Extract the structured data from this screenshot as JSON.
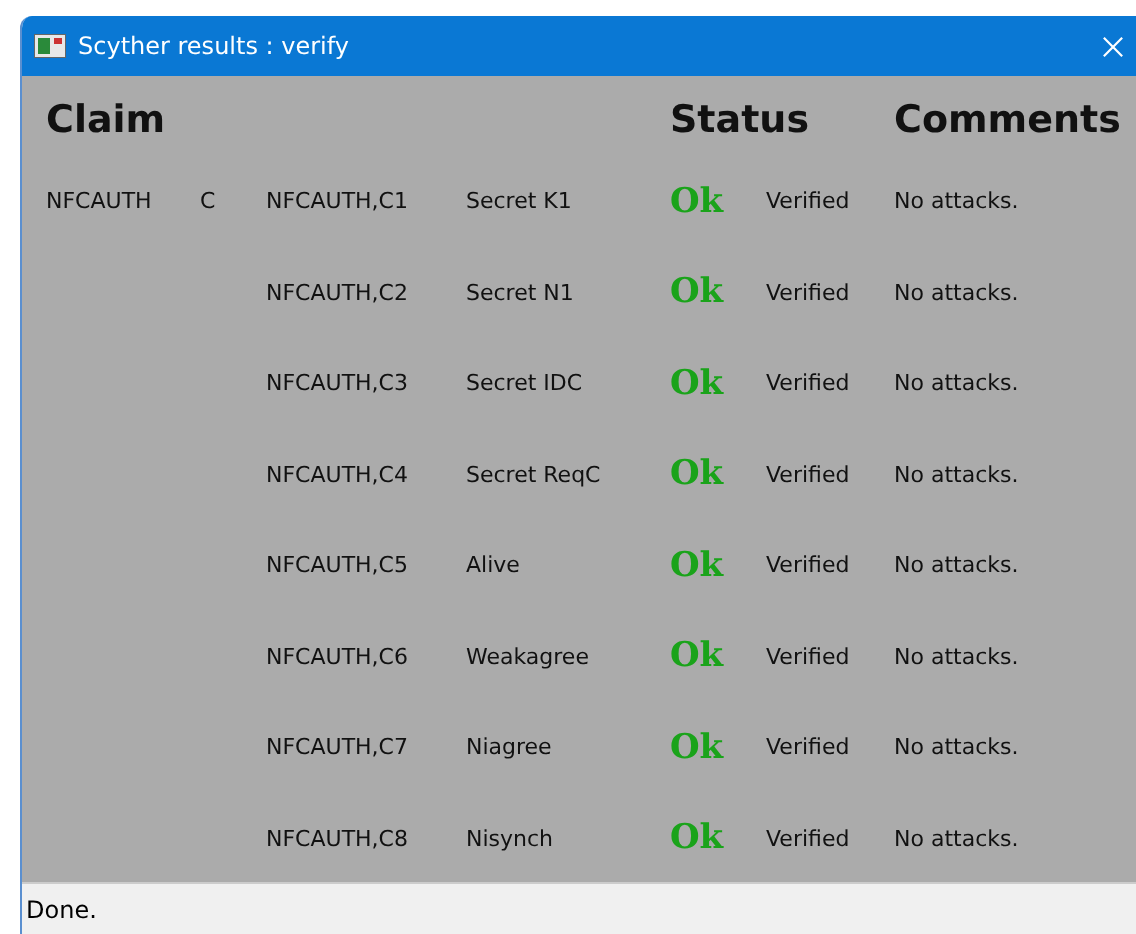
{
  "window": {
    "title": "Scyther results : verify"
  },
  "headers": {
    "claim": "Claim",
    "status": "Status",
    "comments": "Comments"
  },
  "rows": [
    {
      "protocol": "NFCAUTH",
      "role": "C",
      "claim_id": "NFCAUTH,C1",
      "claim": "Secret K1",
      "result": "Ok",
      "status": "Verified",
      "comment": "No attacks."
    },
    {
      "claim_id": "NFCAUTH,C2",
      "claim": "Secret N1",
      "result": "Ok",
      "status": "Verified",
      "comment": "No attacks."
    },
    {
      "claim_id": "NFCAUTH,C3",
      "claim": "Secret IDC",
      "result": "Ok",
      "status": "Verified",
      "comment": "No attacks."
    },
    {
      "claim_id": "NFCAUTH,C4",
      "claim": "Secret ReqC",
      "result": "Ok",
      "status": "Verified",
      "comment": "No attacks."
    },
    {
      "claim_id": "NFCAUTH,C5",
      "claim": "Alive",
      "result": "Ok",
      "status": "Verified",
      "comment": "No attacks."
    },
    {
      "claim_id": "NFCAUTH,C6",
      "claim": "Weakagree",
      "result": "Ok",
      "status": "Verified",
      "comment": "No attacks."
    },
    {
      "claim_id": "NFCAUTH,C7",
      "claim": "Niagree",
      "result": "Ok",
      "status": "Verified",
      "comment": "No attacks."
    },
    {
      "claim_id": "NFCAUTH,C8",
      "claim": "Nisynch",
      "result": "Ok",
      "status": "Verified",
      "comment": "No attacks."
    }
  ],
  "status_bar": "Done."
}
